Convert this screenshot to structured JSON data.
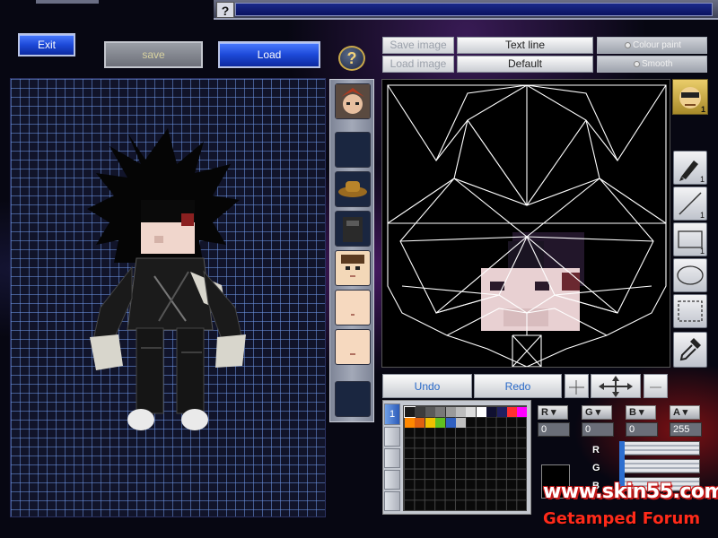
{
  "window": {
    "help_label": "?"
  },
  "toolbar": {
    "exit_label": "Exit",
    "save_label": "save",
    "load_label": "Load",
    "help_label": "?"
  },
  "image_controls": {
    "save_image_label": "Save image",
    "load_image_label": "Load image",
    "text_line_label": "Text line",
    "default_label": "Default",
    "colour_paint_label": "Colour paint",
    "smooth_label": "Smooth"
  },
  "edit_controls": {
    "undo_label": "Undo",
    "redo_label": "Redo"
  },
  "tools": {
    "pen_count": "1",
    "line_count": "1",
    "rect_count": "1",
    "portrait_count": "1"
  },
  "palette": {
    "tab_number": "1",
    "colors": [
      "#1a1a1a",
      "#3c3c3c",
      "#5a5a5a",
      "#787878",
      "#9a9a9a",
      "#bcbcbc",
      "#dcdcdc",
      "#ffffff",
      "#101030",
      "#202060",
      "#ff3030",
      "#ff00ff",
      "#ff8800",
      "#e06010",
      "#f0c000",
      "#60c020",
      "#3060c0",
      "#c0c0c0"
    ]
  },
  "rgba": {
    "r_label": "R",
    "g_label": "G",
    "b_label": "B",
    "a_label": "A",
    "r_value": "0",
    "g_value": "0",
    "b_value": "0",
    "a_value": "255"
  },
  "watermark": {
    "url": "www.skin55.com",
    "forum": "Getamped Forum"
  },
  "colors": {
    "accent_blue": "#1d49d8",
    "grid_line": "#6e96e6",
    "watermark_red": "#ff2a1a"
  }
}
